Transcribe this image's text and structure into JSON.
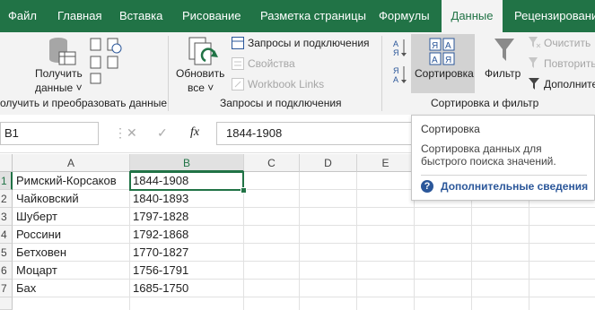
{
  "tabs": [
    {
      "label": "Файл",
      "active": false
    },
    {
      "label": "Главная",
      "active": false
    },
    {
      "label": "Вставка",
      "active": false
    },
    {
      "label": "Рисование",
      "active": false
    },
    {
      "label": "Разметка страницы",
      "active": false
    },
    {
      "label": "Формулы",
      "active": false
    },
    {
      "label": "Данные",
      "active": true
    },
    {
      "label": "Рецензирование",
      "active": false
    }
  ],
  "ribbon": {
    "get_data": {
      "label1": "Получить",
      "label2": "данные ˅",
      "group": "олучить и преобразовать данные"
    },
    "refresh": {
      "label1": "Обновить",
      "label2": "все ˅"
    },
    "queries": {
      "item1": "Запросы и подключения",
      "item2": "Свойства",
      "item3": "Workbook Links",
      "group": "Запросы и подключения"
    },
    "sort": {
      "label": "Сортировка",
      "filter": "Фильтр",
      "clear": "Очистить",
      "reapply": "Повторить",
      "advanced": "Дополнитель",
      "group": "Сортировка и фильтр"
    }
  },
  "formula_bar": {
    "name_box": "B1",
    "fx": "fx",
    "value": "1844-1908"
  },
  "columns": [
    "A",
    "B",
    "C",
    "D",
    "E"
  ],
  "rows": [
    {
      "n": "1",
      "a": "Римский-Корсаков",
      "b": "1844-1908"
    },
    {
      "n": "2",
      "a": "Чайковский",
      "b": "1840-1893"
    },
    {
      "n": "3",
      "a": "Шуберт",
      "b": "1797-1828"
    },
    {
      "n": "4",
      "a": "Россини",
      "b": "1792-1868"
    },
    {
      "n": "5",
      "a": "Бетховен",
      "b": "1770-1827"
    },
    {
      "n": "6",
      "a": "Моцарт",
      "b": "1756-1791"
    },
    {
      "n": "7",
      "a": "Бах",
      "b": "1685-1750"
    }
  ],
  "tooltip": {
    "title": "Сортировка",
    "body1": "Сортировка данных для",
    "body2": "быстрого поиска значений.",
    "link": "Дополнительные сведения"
  },
  "colors": {
    "accent": "#217346",
    "link": "#2b579a"
  }
}
